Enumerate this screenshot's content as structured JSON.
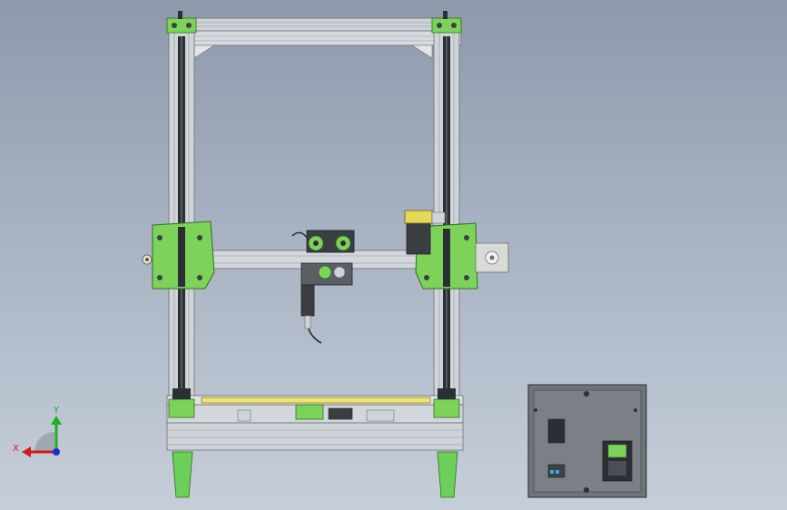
{
  "viewport": {
    "background_top": "#8e9aab",
    "background_bottom": "#c6ced9"
  },
  "model": {
    "frame_color": "#c9ced3",
    "bracket_color": "#7dd35a",
    "dark_color": "#2b2f33",
    "leg_color": "#6ccf5a",
    "electronics_box_color": "#6f7479"
  },
  "triad": {
    "x_label": "X",
    "y_label": "Y",
    "x_color": "#d11a1a",
    "y_color": "#18b31a",
    "z_color": "#1a2fd1"
  }
}
